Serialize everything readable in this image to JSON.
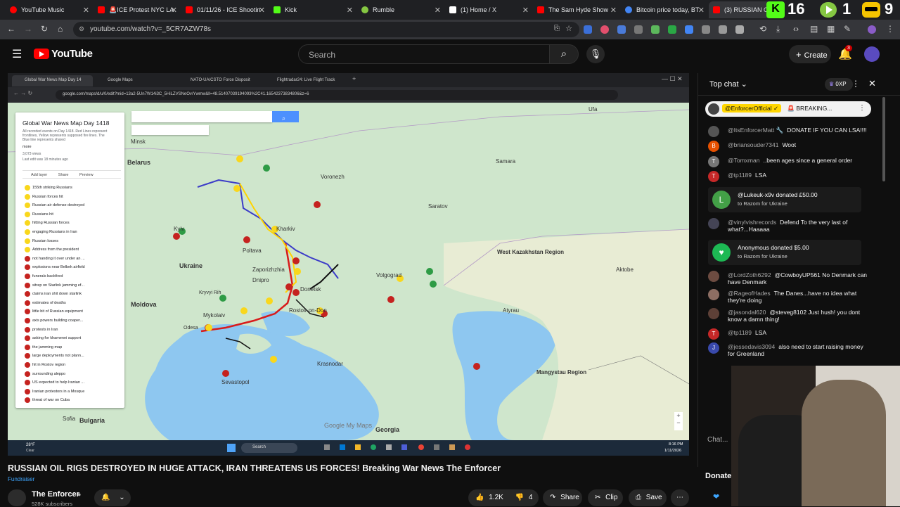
{
  "browser": {
    "tabs": [
      {
        "label": "YouTube Music",
        "color": "#ff0000"
      },
      {
        "label": "🚨ICE Protest NYC LA",
        "color": "#ff0000"
      },
      {
        "label": "01/11/26 - ICE Shootin",
        "color": "#ff0000"
      },
      {
        "label": "Kick",
        "color": "#53fc18"
      },
      {
        "label": "Rumble",
        "color": "#85c742"
      },
      {
        "label": "(1) Home / X",
        "color": "#ffffff"
      },
      {
        "label": "The Sam Hyde Show",
        "color": "#ff0000"
      },
      {
        "label": "Bitcoin price today, BT",
        "color": "#4285f4"
      },
      {
        "label": "(3) RUSSIAN OIL",
        "color": "#ff0000"
      }
    ],
    "url": "youtube.com/watch?v=_5CR7AZW78s",
    "overlay_digits": [
      "16",
      "1",
      "9"
    ]
  },
  "youtube": {
    "logo": "YouTube",
    "search_placeholder": "Search",
    "create_label": "Create",
    "notif_count": "3"
  },
  "video": {
    "inner_tabs": [
      "Global War News Map Day 14",
      "Google Maps",
      "NATO-UA/CSTO Force Disposit",
      "Flightradar24: Live Flight Track"
    ],
    "inner_url": "google.com/maps/d/u/0/edit?mid=13a2-5Un7W14i3C_5HiLZVSNeOv/Ywmw&ll=48.51407039194093%2C41.16542373834806&z=6",
    "panel": {
      "title": "Global War News Map Day 1418",
      "desc": "All recorded events on Day 1418. Red Lines represent frontlines, Yellow represents supposed fire lines. The Blue line represents shared",
      "more": "more",
      "views": "3,073 views",
      "last_edit": "Last edit was 18 minutes ago",
      "actions": [
        "Add layer",
        "Share",
        "Preview"
      ],
      "legend": [
        {
          "label": "155th striking Russians",
          "color": "#f9d71c"
        },
        {
          "label": "Russian forces hit",
          "color": "#f9d71c"
        },
        {
          "label": "Russian air defense destroyed",
          "color": "#f9d71c"
        },
        {
          "label": "Russians hit",
          "color": "#f9d71c"
        },
        {
          "label": "hitting Russian forces",
          "color": "#f9d71c"
        },
        {
          "label": "engaging Russians in Iran",
          "color": "#f9d71c"
        },
        {
          "label": "Russian losses",
          "color": "#f9d71c"
        },
        {
          "label": "Address from the president",
          "color": "#f9d71c"
        },
        {
          "label": "not handing it over under an ...",
          "color": "#c5221f"
        },
        {
          "label": "explosions near Belbek airfield",
          "color": "#c5221f"
        },
        {
          "label": "funerals backfired",
          "color": "#c5221f"
        },
        {
          "label": "sitrep on Starlink jamming ef...",
          "color": "#c5221f"
        },
        {
          "label": "claims iran shit down starlink",
          "color": "#c5221f"
        },
        {
          "label": "estimates of deaths",
          "color": "#c5221f"
        },
        {
          "label": "little bit of Russian equipment",
          "color": "#c5221f"
        },
        {
          "label": "axis powers building coaper...",
          "color": "#c5221f"
        },
        {
          "label": "protests in Iran",
          "color": "#c5221f"
        },
        {
          "label": "asking for khamenei support",
          "color": "#c5221f"
        },
        {
          "label": "the jamming map",
          "color": "#c5221f"
        },
        {
          "label": "large deployments not plann...",
          "color": "#c5221f"
        },
        {
          "label": "hit in Rostov region",
          "color": "#c5221f"
        },
        {
          "label": "surrounding aleppo",
          "color": "#c5221f"
        },
        {
          "label": "US expected to help Iranian ...",
          "color": "#c5221f"
        },
        {
          "label": "Iranian protestors in a Mosque",
          "color": "#c5221f"
        },
        {
          "label": "threat of war on Cuba",
          "color": "#c5221f"
        }
      ]
    },
    "places": [
      {
        "name": "Minsk",
        "sub": "Мінск"
      },
      {
        "name": "Belarus",
        "sub": ""
      },
      {
        "name": "Ufa",
        "sub": "Уфа"
      },
      {
        "name": "Samara",
        "sub": "Самара"
      },
      {
        "name": "Voronezh",
        "sub": "Воронеж"
      },
      {
        "name": "Saratov",
        "sub": "Саратов"
      },
      {
        "name": "Kyiv",
        "sub": "Київ"
      },
      {
        "name": "Kharkiv",
        "sub": "Харків"
      },
      {
        "name": "Poltava",
        "sub": "Полтава"
      },
      {
        "name": "Ukraine",
        "sub": ""
      },
      {
        "name": "Dnipro",
        "sub": "Дніпро"
      },
      {
        "name": "Zaporizhzhia",
        "sub": "Запоріжжя"
      },
      {
        "name": "Kryvyi Rih",
        "sub": "Кривий Ріг"
      },
      {
        "name": "Moldova",
        "sub": ""
      },
      {
        "name": "Mykolaiv",
        "sub": "Миколаїв"
      },
      {
        "name": "Odesa",
        "sub": "Одеса"
      },
      {
        "name": "Donetsk",
        "sub": "Донецьк"
      },
      {
        "name": "Rostov-on-Don",
        "sub": "Ростов-на-Дону"
      },
      {
        "name": "Volgograd",
        "sub": "Волгоград"
      },
      {
        "name": "West Kazakhstan Region",
        "sub": ""
      },
      {
        "name": "Aktobe",
        "sub": "Актобе"
      },
      {
        "name": "Atyrau",
        "sub": "Атырау"
      },
      {
        "name": "Krasnodar",
        "sub": "Краснодар"
      },
      {
        "name": "Sevastopol",
        "sub": "Севастополь"
      },
      {
        "name": "Mangystau Region",
        "sub": ""
      },
      {
        "name": "Bulgaria",
        "sub": ""
      },
      {
        "name": "Georgia",
        "sub": ""
      },
      {
        "name": "Sofia",
        "sub": "София"
      }
    ],
    "google_logo": "Google My Maps",
    "taskbar": {
      "weather": "28°F",
      "weather_sub": "Clear",
      "search": "Search",
      "time": "8:16 PM",
      "date": "1/11/2026"
    }
  },
  "below": {
    "title": "RUSSIAN OIL RIGS DESTROYED IN HUGE ATTACK, IRAN THREATENS US FORCES! Breaking War News The Enforcer",
    "fundraiser": "Fundraiser",
    "channel": "The Enforcer",
    "subscribers": "528K subscribers",
    "likes": "1.2K",
    "dislikes": "4",
    "share": "Share",
    "clip": "Clip",
    "save": "Save"
  },
  "chat": {
    "header": "Top chat",
    "points": "0XP",
    "pinned_author": "@EnforcerOfficial ✓",
    "pinned_text": "🚨 BREAKING...",
    "messages": [
      {
        "author": "@ItsEnforcerMatt 🔧",
        "text": "DONATE IF YOU CAN LSA!!!!",
        "color": "#555",
        "initial": ""
      },
      {
        "author": "@briansouder7341",
        "text": "Woot",
        "color": "#e65100",
        "initial": "B"
      },
      {
        "author": "@Tomxman",
        "text": "..been ages since a general order",
        "color": "#777",
        "initial": "T"
      },
      {
        "author": "@tp1189",
        "text": "LSA",
        "color": "#c62828",
        "initial": "T"
      },
      {
        "author": "@vinylvishrecords",
        "text": "Defend To the very last of what?...Haaaaa",
        "color": "#445",
        "initial": ""
      },
      {
        "author": "@LordZoth6292",
        "text": "@CowboyUP561 No Denmark can have Denmark",
        "color": "#6d4c41",
        "initial": ""
      },
      {
        "author": "@RageofHades",
        "text": "The Danes...have no idea what they're doing",
        "color": "#8d6e63",
        "initial": ""
      },
      {
        "author": "@jasondal620",
        "text": "@steveg8102 Just hush! you dont know a damn thing!",
        "color": "#5d4037",
        "initial": ""
      },
      {
        "author": "@tp1189",
        "text": "LSA",
        "color": "#c62828",
        "initial": "T"
      },
      {
        "author": "@jessedavis3094",
        "text": "also need to start raising money for Greenland",
        "color": "#3949ab",
        "initial": "J"
      }
    ],
    "donations": [
      {
        "name": "@Lukeuk-x9v donated £50.00",
        "to": "to Razom for Ukraine",
        "color": "#43a047",
        "initial": "L"
      },
      {
        "name": "Anonymous donated $5.00",
        "to": "to Razom for Ukraine",
        "color": "#1db954",
        "initial": "♥"
      }
    ],
    "input_label": "Chat...",
    "donate_label": "Donate"
  }
}
